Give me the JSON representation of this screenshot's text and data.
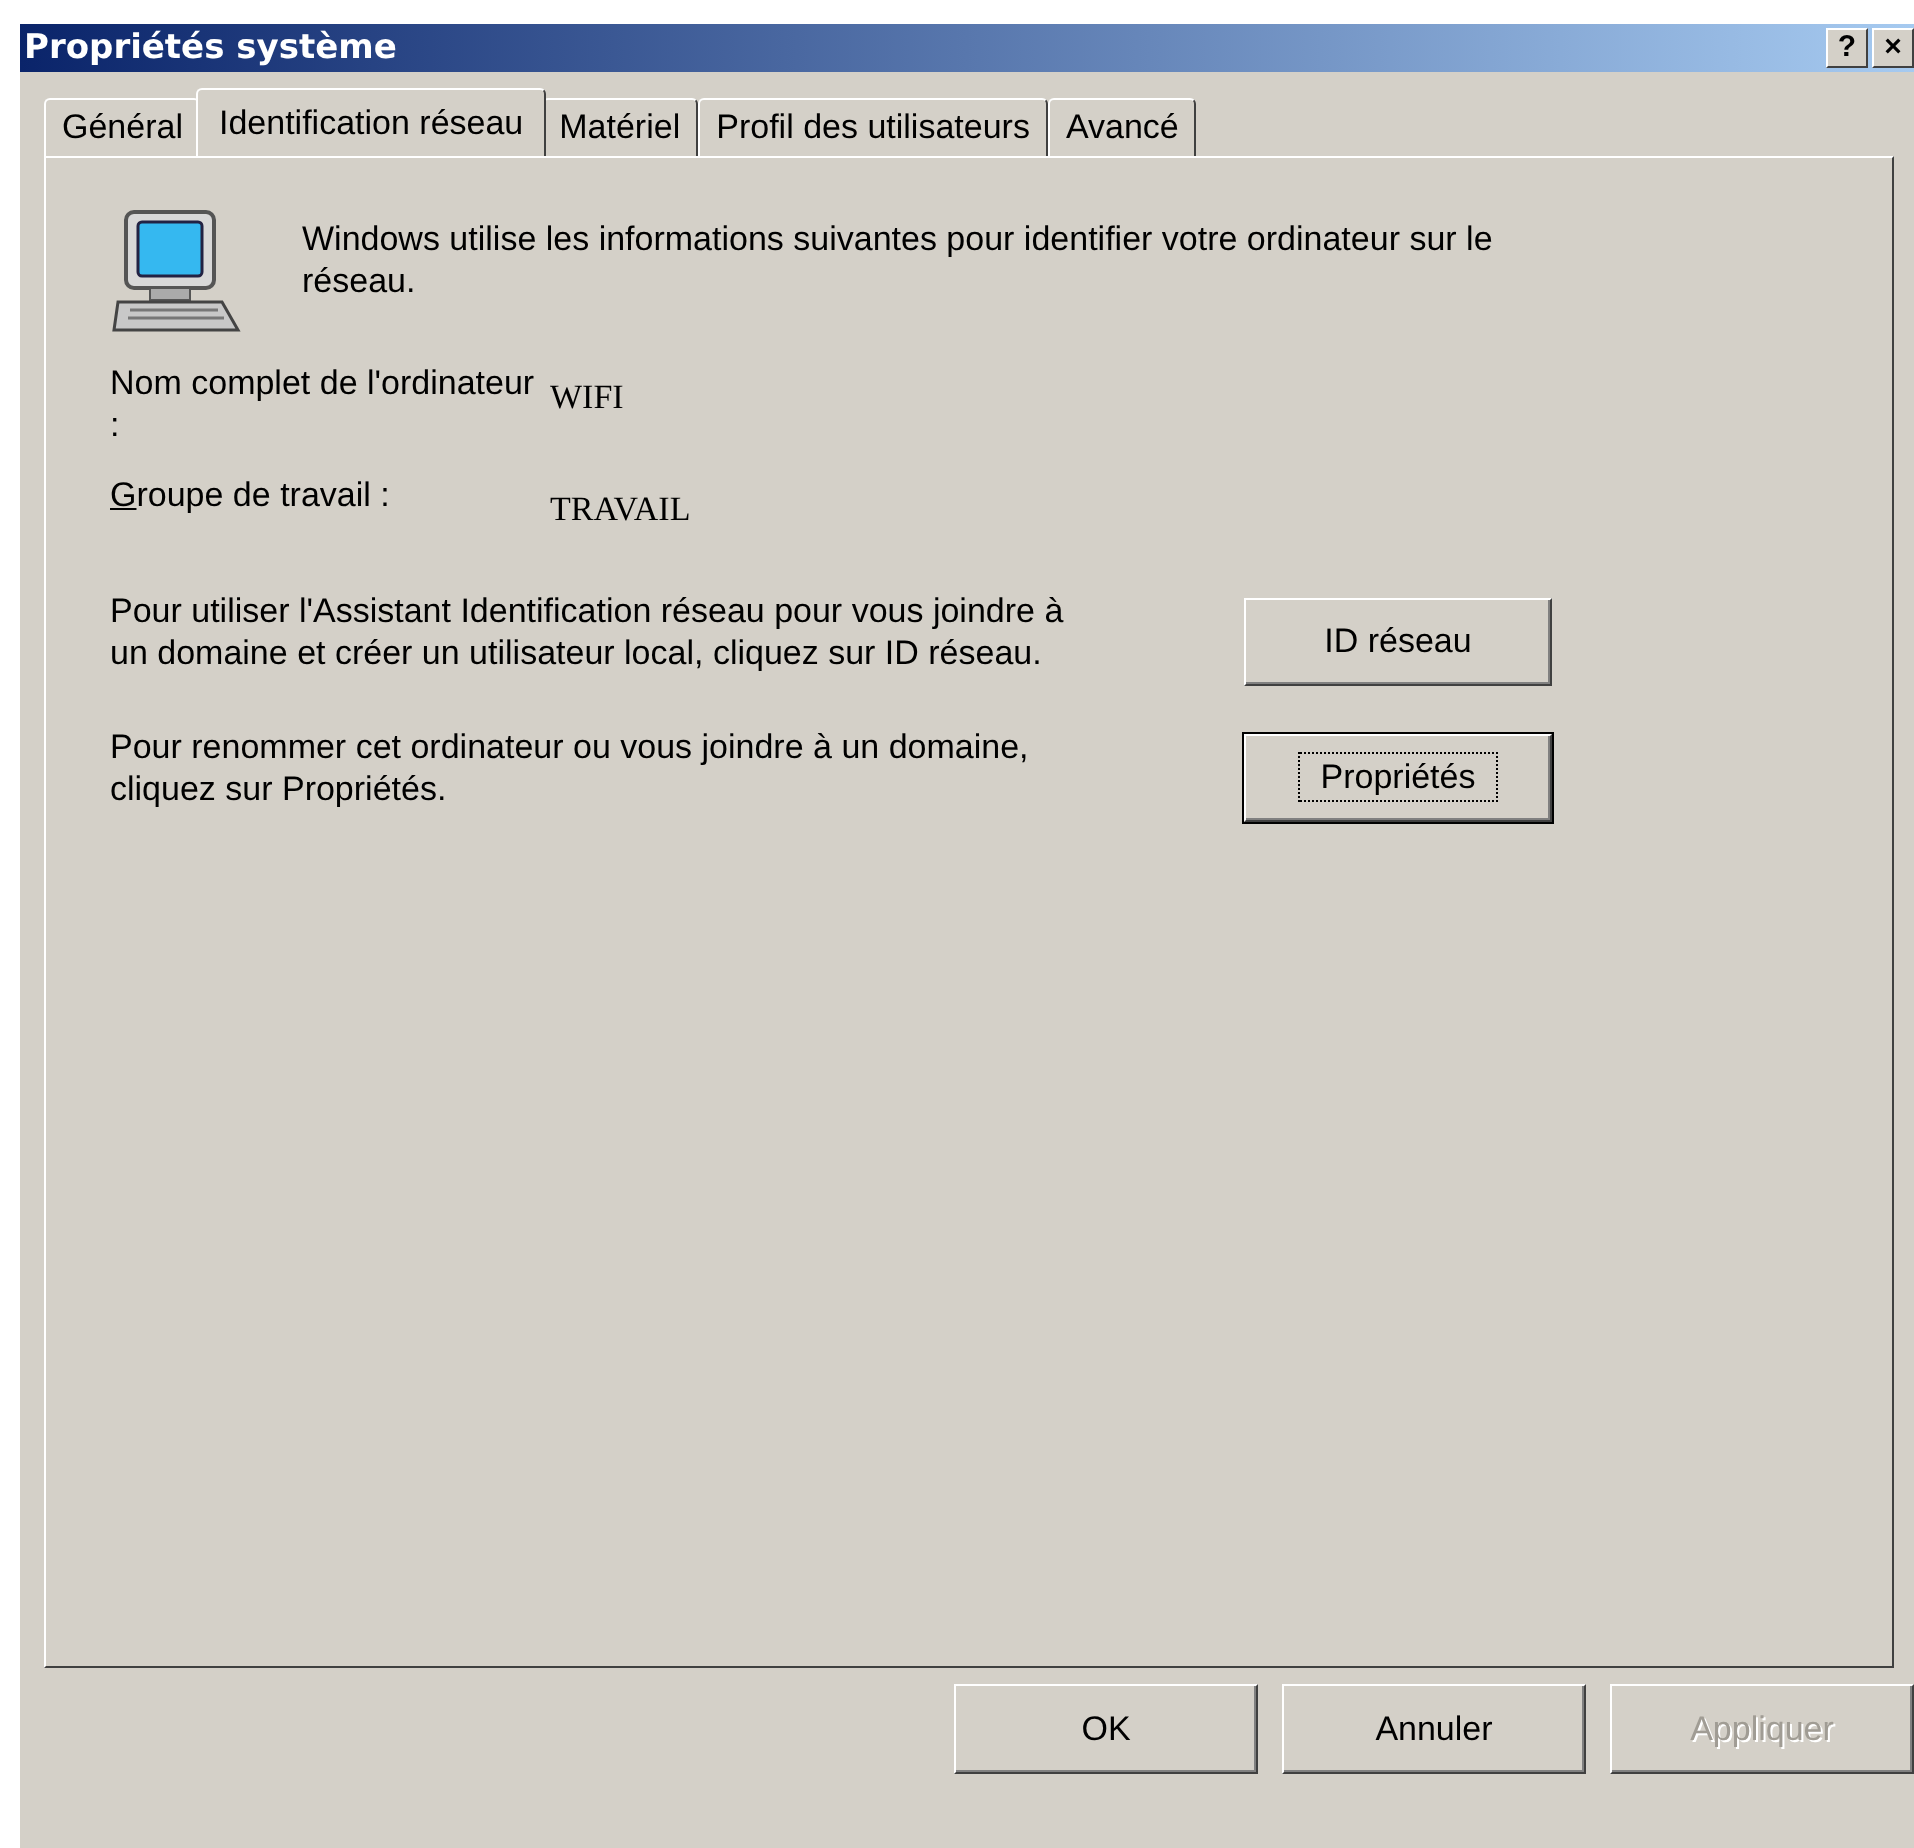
{
  "window": {
    "title": "Propriétés système",
    "controls": [
      "?",
      "×"
    ]
  },
  "tabs": [
    {
      "label": "Général",
      "selected": false
    },
    {
      "label": "Identification réseau",
      "selected": true
    },
    {
      "label": "Matériel",
      "selected": false
    },
    {
      "label": "Profil des utilisateurs",
      "selected": false
    },
    {
      "label": "Avancé",
      "selected": false
    }
  ],
  "intro": "Windows utilise les informations suivantes pour identifier votre ordinateur sur le réseau.",
  "fields": [
    {
      "label": "Nom complet de l'ordinateur :",
      "value": "WIFI"
    },
    {
      "label": "Groupe de travail :",
      "value": "TRAVAIL"
    }
  ],
  "actions": [
    {
      "text": "Pour utiliser l'Assistant Identification réseau pour vous joindre à un domaine et créer un utilisateur local, cliquez sur ID réseau.",
      "button": "ID réseau",
      "default": false
    },
    {
      "text": "Pour renommer cet ordinateur ou vous joindre à un domaine, cliquez sur Propriétés.",
      "button": "Propriétés",
      "default": true
    }
  ],
  "buttons": [
    {
      "label": "OK",
      "disabled": false
    },
    {
      "label": "Annuler",
      "disabled": false
    },
    {
      "label": "Appliquer",
      "disabled": true
    }
  ]
}
